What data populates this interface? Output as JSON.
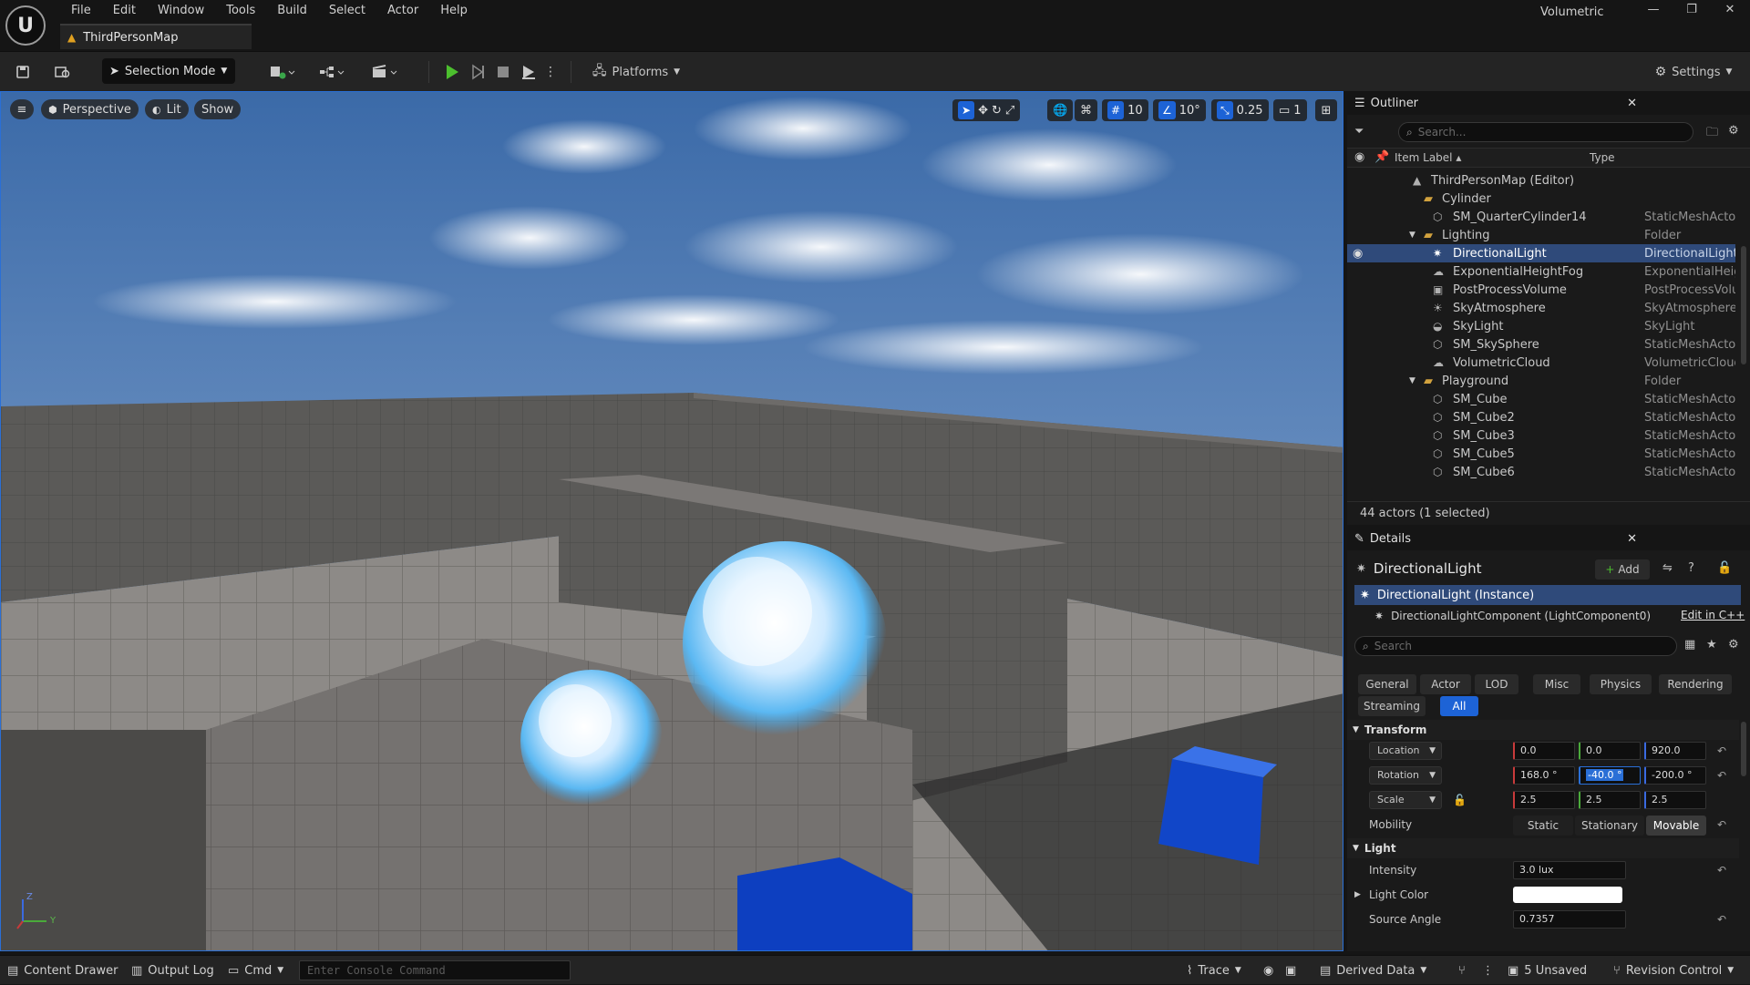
{
  "app": {
    "window_title": "Volumetric",
    "map_tab": "ThirdPersonMap",
    "logo_text": "U"
  },
  "menu": [
    "File",
    "Edit",
    "Window",
    "Tools",
    "Build",
    "Select",
    "Actor",
    "Help"
  ],
  "toolbar": {
    "selection_mode": "Selection Mode",
    "platforms": "Platforms",
    "settings": "Settings"
  },
  "viewport": {
    "perspective": "Perspective",
    "lit": "Lit",
    "show": "Show",
    "grid_snap": "10",
    "rotation_snap": "10°",
    "scale_snap": "0.25",
    "camera_speed": "1",
    "axis_z": "Z",
    "axis_y": "Y"
  },
  "outliner": {
    "title": "Outliner",
    "search_placeholder": "Search...",
    "col_label": "Item Label ▴",
    "col_type": "Type",
    "items": [
      {
        "label": "ThirdPersonMap (Editor)",
        "type": ""
      },
      {
        "label": "Cylinder",
        "type": ""
      },
      {
        "label": "SM_QuarterCylinder14",
        "type": "StaticMeshActor"
      },
      {
        "label": "Lighting",
        "type": "Folder"
      },
      {
        "label": "DirectionalLight",
        "type": "DirectionalLight"
      },
      {
        "label": "ExponentialHeightFog",
        "type": "ExponentialHeigh"
      },
      {
        "label": "PostProcessVolume",
        "type": "PostProcessVolu"
      },
      {
        "label": "SkyAtmosphere",
        "type": "SkyAtmosphere"
      },
      {
        "label": "SkyLight",
        "type": "SkyLight"
      },
      {
        "label": "SM_SkySphere",
        "type": "StaticMeshActor"
      },
      {
        "label": "VolumetricCloud",
        "type": "VolumetricCloud"
      },
      {
        "label": "Playground",
        "type": "Folder"
      },
      {
        "label": "SM_Cube",
        "type": "StaticMeshActor"
      },
      {
        "label": "SM_Cube2",
        "type": "StaticMeshActor"
      },
      {
        "label": "SM_Cube3",
        "type": "StaticMeshActor"
      },
      {
        "label": "SM_Cube5",
        "type": "StaticMeshActor"
      },
      {
        "label": "SM_Cube6",
        "type": "StaticMeshActor"
      }
    ],
    "footer": "44 actors (1 selected)"
  },
  "details": {
    "title": "Details",
    "actor_name": "DirectionalLight",
    "add_label": "Add",
    "instance": "DirectionalLight (Instance)",
    "component": "DirectionalLightComponent (LightComponent0)",
    "edit_cpp": "Edit in C++",
    "search_placeholder": "Search",
    "filters": [
      "General",
      "Actor",
      "LOD",
      "Misc",
      "Physics",
      "Rendering",
      "Streaming",
      "All"
    ],
    "transform_section": "Transform",
    "location_label": "Location",
    "location": [
      "0.0",
      "0.0",
      "920.0"
    ],
    "rotation_label": "Rotation",
    "rotation": [
      "168.0 °",
      "-40.0 °",
      "-200.0 °"
    ],
    "scale_label": "Scale",
    "scale": [
      "2.5",
      "2.5",
      "2.5"
    ],
    "mobility_label": "Mobility",
    "mobility_options": [
      "Static",
      "Stationary",
      "Movable"
    ],
    "light_section": "Light",
    "intensity_label": "Intensity",
    "intensity": "3.0 lux",
    "light_color_label": "Light Color",
    "light_color": "#ffffff",
    "source_angle_label": "Source Angle",
    "source_angle": "0.7357"
  },
  "statusbar": {
    "content_drawer": "Content Drawer",
    "output_log": "Output Log",
    "cmd": "Cmd",
    "console_placeholder": "Enter Console Command",
    "trace": "Trace",
    "derived_data": "Derived Data",
    "unsaved": "5 Unsaved",
    "revision_control": "Revision Control"
  },
  "colors": {
    "accent": "#1d63d6",
    "selected_row": "#2f4a7a",
    "folder": "#d2a23e"
  }
}
